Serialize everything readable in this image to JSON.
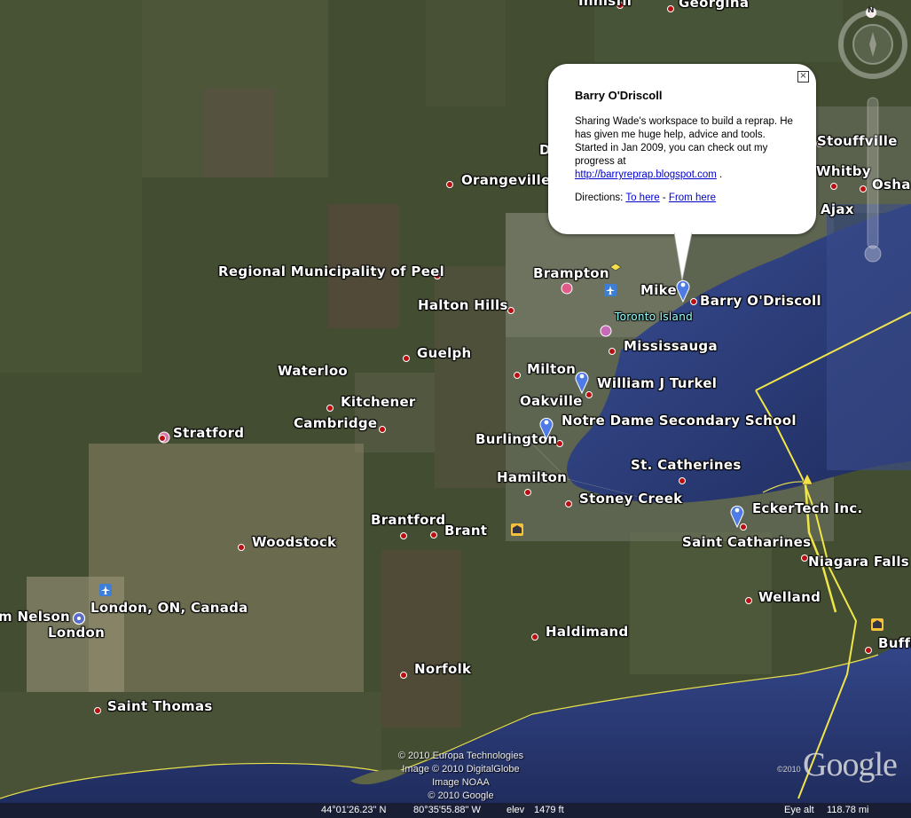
{
  "map": {
    "colors": {
      "land_dark": "#3f4a2e",
      "land_light": "#8f8c6e",
      "water": "#2a3a73",
      "water_light": "#3a4f96",
      "border": "#f0e64a",
      "urban": "#7c7c72",
      "place_dot": "#b81010",
      "pin": "#4e7be6"
    },
    "places": {
      "innisfil": "Innisfil",
      "georgina": "Georgina",
      "orangeville": "Orangeville",
      "stouffville": "Stouffville",
      "whitby": "Whitby",
      "oshawa": "Osha",
      "ajax": "Ajax",
      "peel": "Regional Municipality of Peel",
      "halton_hills": "Halton Hills",
      "brampton": "Brampton",
      "mike": "Mike",
      "barry": "Barry O'Driscoll",
      "toronto_island": "Toronto Island",
      "mississauga": "Mississauga",
      "guelph": "Guelph",
      "waterloo": "Waterloo",
      "milton": "Milton",
      "william": "William J Turkel",
      "kitchener": "Kitchener",
      "oakville": "Oakville",
      "cambridge": "Cambridge",
      "notre_dame": "Notre Dame Secondary School",
      "stratford": "Stratford",
      "burlington": "Burlington",
      "st_catherines": "St. Catherines",
      "hamilton": "Hamilton",
      "stoney_creek": "Stoney Creek",
      "brantford": "Brantford",
      "brant": "Brant",
      "eckertech": "EckerTech Inc.",
      "woodstock": "Woodstock",
      "saint_catharines": "Saint Catharines",
      "niagara_falls": "Niagara Falls",
      "nelson": "m Nelson",
      "london_on": "London, ON, Canada",
      "welland": "Welland",
      "london": "London",
      "haldimand": "Haldimand",
      "buffalo": "Buffa",
      "norfolk": "Norfolk",
      "saint_thomas": "Saint Thomas"
    },
    "d_letter": "D"
  },
  "popup": {
    "title": "Barry O'Driscoll",
    "description": "Sharing Wade's workspace to build a reprap. He has given me huge help, advice and tools. Started in Jan 2009, you can check out my progress at",
    "link": "http://barryreprap.blogspot.com",
    "link_suffix": " .",
    "directions_label": "Directions:",
    "to_here": "To here",
    "separator": " - ",
    "from_here": "From here",
    "close_glyph": "×"
  },
  "credits": {
    "line1": "© 2010 Europa Technologies",
    "line2": "Image © 2010 DigitalGlobe",
    "line3": "Image NOAA",
    "line4": "© 2010 Google"
  },
  "logo": {
    "text": "Google",
    "year": "©2010"
  },
  "statusbar": {
    "lat": "44°01'26.23\" N",
    "lon": "80°35'55.88\" W",
    "elev_label": "elev",
    "elev": "1479 ft",
    "eye_label": "Eye alt",
    "eye": "118.78 mi"
  },
  "compass": {
    "north": "N"
  }
}
